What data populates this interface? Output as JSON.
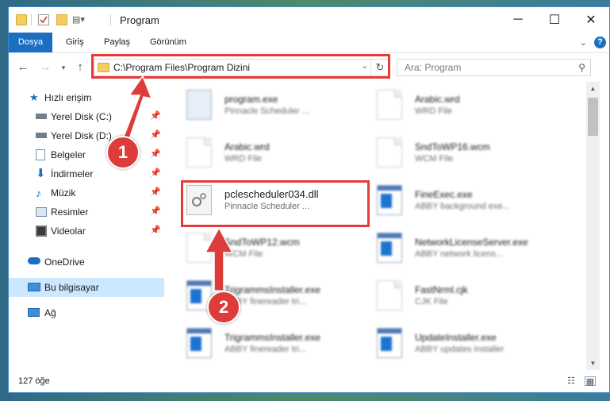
{
  "window": {
    "title": "Program"
  },
  "ribbon": {
    "tabs": [
      "Dosya",
      "Giriş",
      "Paylaş",
      "Görünüm"
    ],
    "help_label": "?"
  },
  "nav": {
    "address": "C:\\Program Files\\Program Dizini",
    "search_placeholder": "Ara: Program"
  },
  "sidebar": {
    "items": [
      {
        "label": "Hızlı erişim",
        "icon": "star-icon",
        "pinned": false
      },
      {
        "label": "Yerel Disk (C:)",
        "icon": "drive-icon",
        "pinned": true
      },
      {
        "label": "Yerel Disk (D:)",
        "icon": "drive-icon",
        "pinned": true
      },
      {
        "label": "Belgeler",
        "icon": "documents-icon",
        "pinned": true
      },
      {
        "label": "İndirmeler",
        "icon": "downloads-icon",
        "pinned": true
      },
      {
        "label": "Müzik",
        "icon": "music-icon",
        "pinned": true
      },
      {
        "label": "Resimler",
        "icon": "pictures-icon",
        "pinned": true
      },
      {
        "label": "Videolar",
        "icon": "videos-icon",
        "pinned": true
      },
      {
        "label": "OneDrive",
        "icon": "cloud-icon",
        "pinned": false
      },
      {
        "label": "Bu bilgisayar",
        "icon": "computer-icon",
        "pinned": false
      },
      {
        "label": "Ağ",
        "icon": "network-icon",
        "pinned": false
      }
    ]
  },
  "files": [
    {
      "name": "program.exe",
      "type": "Pinnacle Scheduler ...",
      "kind": "program-icon"
    },
    {
      "name": "Arabic.wrd",
      "type": "WRD File",
      "kind": "document-icon"
    },
    {
      "name": "Arabic.wrd",
      "type": "WRD File",
      "kind": "document-icon"
    },
    {
      "name": "SndToWP16.wcm",
      "type": "WCM File",
      "kind": "document-icon"
    },
    {
      "name": "pclescheduler034.dll",
      "type": "Pinnacle Scheduler ...",
      "kind": "dll-gear-icon"
    },
    {
      "name": "FineExec.exe",
      "type": "ABBY background exe...",
      "kind": "app-window-icon"
    },
    {
      "name": "SndToWP12.wcm",
      "type": "WCM File",
      "kind": "document-icon"
    },
    {
      "name": "NetworkLicenseServer.exe",
      "type": "ABBY network licens...",
      "kind": "app-window-icon"
    },
    {
      "name": "TrigrammsInstaller.exe",
      "type": "ABBY finereader tri...",
      "kind": "app-window-icon"
    },
    {
      "name": "FastNrml.cjk",
      "type": "CJK File",
      "kind": "document-icon"
    },
    {
      "name": "TrigrammsInstaller.exe",
      "type": "ABBY finereader tri...",
      "kind": "app-window-icon"
    },
    {
      "name": "UpdateInstaller.exe",
      "type": "ABBY updates installer",
      "kind": "app-window-icon"
    }
  ],
  "status": {
    "count": "127 öğe"
  },
  "callouts": [
    "1",
    "2"
  ],
  "colors": {
    "accent": "#1a6fc0",
    "highlight": "#e63b3b",
    "selected": "#cce8ff"
  }
}
